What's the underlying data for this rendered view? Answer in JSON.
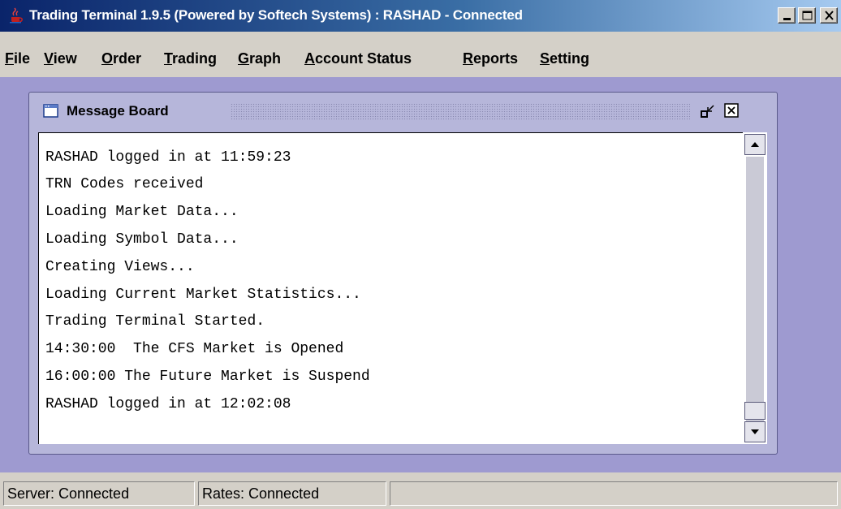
{
  "window": {
    "title": "Trading Terminal 1.9.5 (Powered by Softech Systems)   :   RASHAD - Connected",
    "app_icon": "java-cup-icon",
    "controls": [
      "minimize-icon",
      "maximize-icon",
      "close-icon"
    ]
  },
  "menu": {
    "items": [
      {
        "label": "File",
        "mnemonic": "F"
      },
      {
        "label": "View",
        "mnemonic": "V"
      },
      {
        "label": "Order",
        "mnemonic": "O"
      },
      {
        "label": "Trading",
        "mnemonic": "T"
      },
      {
        "label": "Graph",
        "mnemonic": "G"
      },
      {
        "label": "Account Status",
        "mnemonic": "A"
      },
      {
        "label": "Reports",
        "mnemonic": "R"
      },
      {
        "label": "Setting",
        "mnemonic": "S"
      }
    ]
  },
  "message_board": {
    "title": "Message Board",
    "lines": [
      "RASHAD logged in at 11:59:23",
      "TRN Codes received",
      "Loading Market Data...",
      "Loading Symbol Data...",
      "Creating Views...",
      "Loading Current Market Statistics...",
      "Trading Terminal Started.",
      "14:30:00  The CFS Market is Opened",
      "16:00:00 The Future Market is Suspend",
      "RASHAD logged in at 12:02:08"
    ]
  },
  "status": {
    "server": "Server: Connected",
    "rates": "Rates: Connected",
    "extra": ""
  },
  "colors": {
    "titlebar_start": "#0a246a",
    "titlebar_end": "#a6caf0",
    "desktop": "#9e9ad0",
    "chrome": "#d4d0c8"
  }
}
